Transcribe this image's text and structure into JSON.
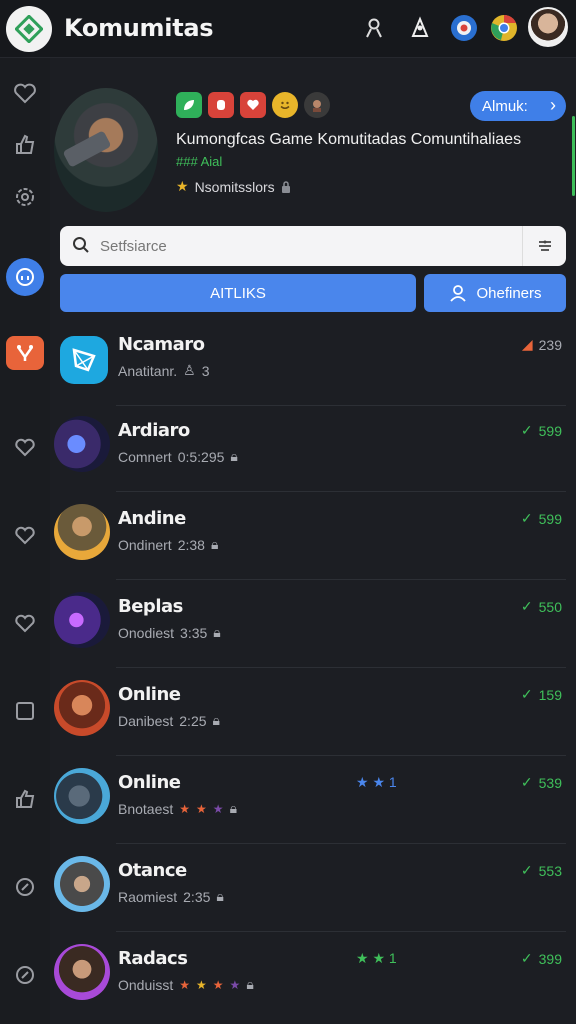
{
  "app": {
    "title": "Komumitas",
    "logo_icon": "diamond-logo-icon",
    "accent": "#3f7fe8",
    "green": "#3fbf5a",
    "orange": "#e8643a"
  },
  "topbar": {
    "icons": [
      "profile-icon",
      "bell-cone-icon",
      "globe-badge-icon",
      "chrome-icon",
      "user-avatar"
    ]
  },
  "community": {
    "name": "Kumongfcas Game Komutitadas Comuntihaliaes",
    "tag": "### Aial",
    "mods_label": "Nsomitsslors",
    "join_label": "Almuk:",
    "badges": [
      {
        "icon": "leaf-badge-icon",
        "color": "#2fb05a"
      },
      {
        "icon": "shield-badge-icon",
        "color": "#d8433a"
      },
      {
        "icon": "heart-badge-icon",
        "color": "#d8433a"
      },
      {
        "icon": "smile-badge-icon",
        "color": "#e8b52a"
      },
      {
        "icon": "mask-badge-icon",
        "color": "#3a3a3a"
      }
    ]
  },
  "search": {
    "placeholder": "Setfsiarce"
  },
  "tabs": {
    "primary": "AITLIKS",
    "secondary": "Ohefiners"
  },
  "rows": [
    {
      "name": "Ncamaro",
      "meta": "Anatitanr.",
      "meta2": "3",
      "count": "239",
      "style": "orange"
    },
    {
      "name": "Ardiaro",
      "meta": "Comnert",
      "meta2": "0:5:295",
      "count": "599",
      "style": "green"
    },
    {
      "name": "Andine",
      "meta": "Ondinert",
      "meta2": "2:38",
      "count": "599",
      "style": "green"
    },
    {
      "name": "Beplas",
      "meta": "Onodiest",
      "meta2": "3:35",
      "count": "550",
      "style": "green"
    },
    {
      "name": "Online",
      "meta": "Danibest",
      "meta2": "2:25",
      "count": "159",
      "style": "green"
    },
    {
      "name": "Online",
      "meta": "Bnotaest",
      "meta2": "",
      "count": "539",
      "style": "green",
      "mid": "1"
    },
    {
      "name": "Otance",
      "meta": "Raomiest",
      "meta2": "2:35",
      "count": "553",
      "style": "green"
    },
    {
      "name": "Radacs",
      "meta": "Onduisst",
      "meta2": "",
      "count": "399",
      "style": "green",
      "mid": "1"
    }
  ]
}
